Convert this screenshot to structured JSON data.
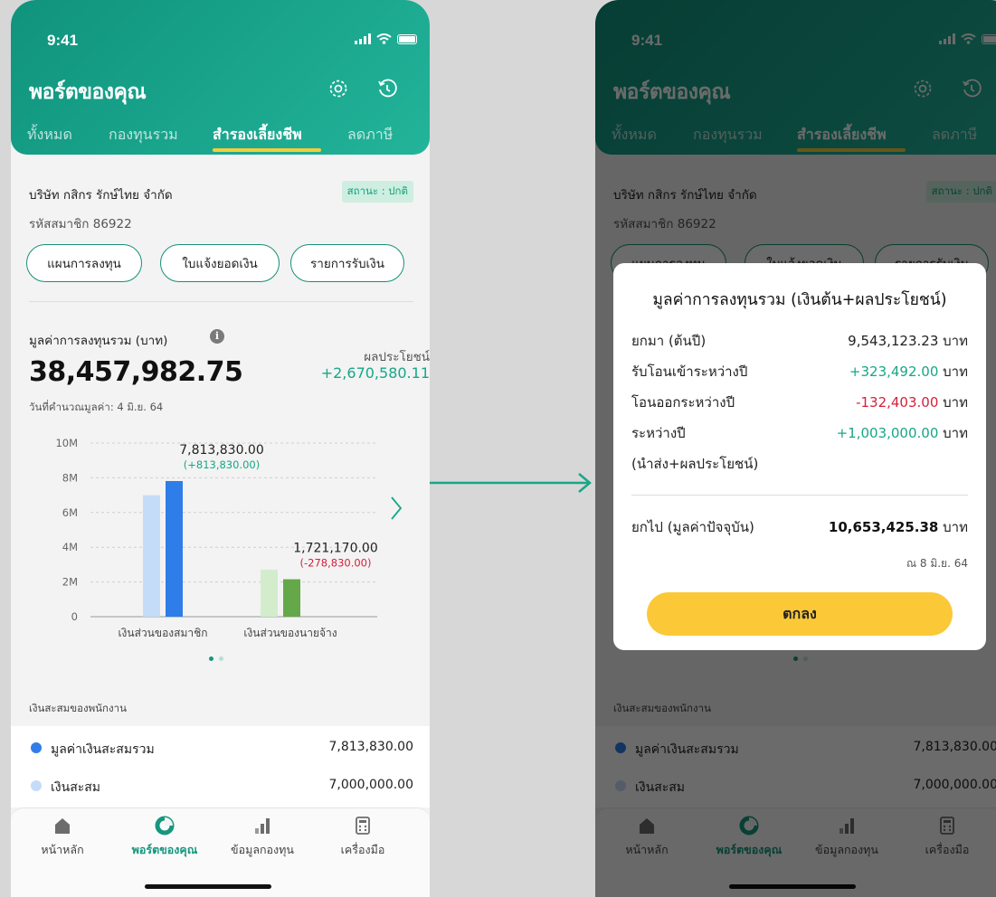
{
  "colors": {
    "primary": "#16977d",
    "accent": "#f6cd3a",
    "positive": "#17a688",
    "negative": "#d4213a",
    "member_light": "#c5dcf8",
    "member_dark": "#2f7de8",
    "employer_light": "#d2eccc",
    "employer_dark": "#64a84a"
  },
  "status": {
    "time": "9:41"
  },
  "header": {
    "title": "พอร์ตของคุณ",
    "settings_icon": "gear-icon",
    "history_icon": "clock-rotate-icon"
  },
  "tabs": [
    {
      "label": "ทั้งหมด"
    },
    {
      "label": "กองทุนรวม"
    },
    {
      "label": "สำรองเลี้ยงชีพ",
      "active": true
    },
    {
      "label": "ลดภาษี"
    }
  ],
  "company": {
    "name": "บริษัท กสิกร รักษ์ไทย จำกัด",
    "status": "สถานะ : ปกติ",
    "member": "รหัสสมาชิก 86922"
  },
  "actions": {
    "plan": "แผนการลงทุน",
    "statement": "ใบแจ้งยอดเงิน",
    "receipts": "รายการรับเงิน"
  },
  "summary": {
    "total_label": "มูลค่าการลงทุนรวม (บาท)",
    "total": "38,457,982.75",
    "profit_label": "ผลประโยชน์",
    "profit": "+2,670,580.11",
    "calc_date": "วันที่คำนวณมูลค่า: 4 มิ.ย. 64"
  },
  "chart_data": {
    "type": "bar",
    "categories": [
      "เงินส่วนของสมาชิก",
      "เงินส่วนของนายจ้าง"
    ],
    "y_ticks": [
      "10M",
      "8M",
      "6M",
      "4M",
      "2M",
      "0"
    ],
    "ylim": [
      0,
      10000000
    ],
    "series": [
      {
        "values": [
          7000000,
          2700000
        ]
      },
      {
        "values": [
          7813830,
          2157000
        ]
      }
    ],
    "annotations": [
      {
        "value": "7,813,830.00",
        "change": "(+813,830.00)"
      },
      {
        "value": "1,721,170.00",
        "change": "(-278,830.00)"
      }
    ]
  },
  "savings": {
    "section_label": "เงินสะสมของพนักงาน",
    "items": [
      {
        "label": "มูลค่าเงินสะสมรวม",
        "value": "7,813,830.00"
      },
      {
        "label": "เงินสะสม",
        "value": "7,000,000.00"
      }
    ]
  },
  "nav": [
    {
      "label": "หน้าหลัก",
      "icon": "home-icon"
    },
    {
      "label": "พอร์ตของคุณ",
      "icon": "pie-chart-icon",
      "active": true
    },
    {
      "label": "ข้อมูลกองทุน",
      "icon": "bar-chart-icon"
    },
    {
      "label": "เครื่องมือ",
      "icon": "calculator-icon"
    }
  ],
  "modal": {
    "title": "มูลค่าการลงทุนรวม (เงินต้น+ผลประโยชน์)",
    "unit": "บาท",
    "rows": [
      {
        "label": "ยกมา (ต้นปี)",
        "value": "9,543,123.23"
      },
      {
        "label": "รับโอนเข้าระหว่างปี",
        "value": "+323,492.00"
      },
      {
        "label": "โอนออกระหว่างปี",
        "value": "-132,403.00"
      },
      {
        "label": "ระหว่างปี",
        "label2": "(นำส่ง+ผลประโยชน์)",
        "value": "+1,003,000.00"
      }
    ],
    "carry_label": "ยกไป (มูลค่าปัจจุบัน)",
    "carry_value": "10,653,425.38",
    "as_of": "ณ 8 มิ.ย. 64",
    "ok": "ตกลง"
  }
}
